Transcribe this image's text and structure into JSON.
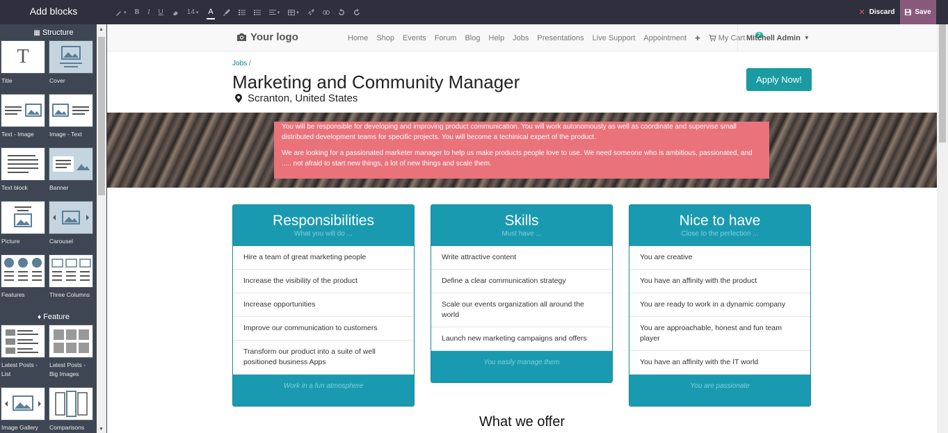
{
  "editor": {
    "add_blocks_label": "Add blocks",
    "font_size": "14",
    "font_color_label": "A",
    "discard_label": "Discard",
    "save_label": "Save"
  },
  "sidebar": {
    "structure_label": "Structure",
    "feature_label": "Feature",
    "structure_blocks": [
      {
        "label": "Title",
        "icon": "title-icon"
      },
      {
        "label": "Cover",
        "icon": "cover-icon"
      },
      {
        "label": "Text - Image",
        "icon": "text-image-icon"
      },
      {
        "label": "Image - Text",
        "icon": "image-text-icon"
      },
      {
        "label": "Text block",
        "icon": "text-block-icon"
      },
      {
        "label": "Banner",
        "icon": "banner-icon"
      },
      {
        "label": "Picture",
        "icon": "picture-icon"
      },
      {
        "label": "Carousel",
        "icon": "carousel-icon"
      },
      {
        "label": "Features",
        "icon": "features-icon"
      },
      {
        "label": "Three Columns",
        "icon": "three-columns-icon"
      }
    ],
    "feature_blocks": [
      {
        "label": "Latest Posts - List",
        "icon": "latest-posts-list-icon"
      },
      {
        "label": "Latest Posts - Big Images",
        "icon": "latest-posts-big-icon"
      },
      {
        "label": "Image Gallery",
        "icon": "image-gallery-icon"
      },
      {
        "label": "Comparisons",
        "icon": "comparisons-icon"
      }
    ]
  },
  "nav": {
    "logo": "Your logo",
    "items": [
      "Home",
      "Shop",
      "Events",
      "Forum",
      "Blog",
      "Help",
      "Jobs",
      "Presentations",
      "Live Support",
      "Appointment"
    ],
    "plus": "+",
    "cart_label": "My Cart",
    "cart_count": "2",
    "user": "Mitchell Admin"
  },
  "job": {
    "breadcrumb_link": "Jobs",
    "breadcrumb_sep": "/",
    "title": "Marketing and Community Manager",
    "location": "Scranton, United States",
    "apply_label": "Apply Now!"
  },
  "banner": {
    "paragraph1": "You will be responsible for developing and improving product communication. You will work autonomously as well as coordinate and supervise small distributed development teams for specific projects. You will become a techinical expert of the product.",
    "paragraph2": "We are looking for a passionated marketer manager to help us make products people love to use. We need someone who is ambitious, passionated, and ..... not afraid to start new things, a lot of new things and scale them."
  },
  "cards": [
    {
      "title": "Responsibilities",
      "subtitle": "What you will do ...",
      "items": [
        "Hire a team of great marketing people",
        "Increase the visibility of the product",
        "Increase opportunities",
        "Improve our communication to customers",
        "Transform our product into a suite of well positioned business Apps"
      ],
      "footer": "Work in a fun atmosphere"
    },
    {
      "title": "Skills",
      "subtitle": "Must have ...",
      "items": [
        "Write attractive content",
        "Define a clear communication strategy",
        "Scale our events organization all around the world",
        "Launch new marketing campaigns and offers"
      ],
      "footer": "You easily manage them"
    },
    {
      "title": "Nice to have",
      "subtitle": "Close to the perfection ...",
      "items": [
        "You are creative",
        "You have an affinity with the product",
        "You are ready to work in a dynamic company",
        "You are approachable, honest and fun team player",
        "You have an affinity with the IT world"
      ],
      "footer": "You are passionate"
    }
  ],
  "offer_title": "What we offer",
  "colors": {
    "accent_teal": "#1a9ab0",
    "banner_pink": "#e9727b",
    "save_purple": "#875a7b",
    "editor_dark": "#2f2f3e",
    "sidebar_dark": "#3e4653"
  }
}
